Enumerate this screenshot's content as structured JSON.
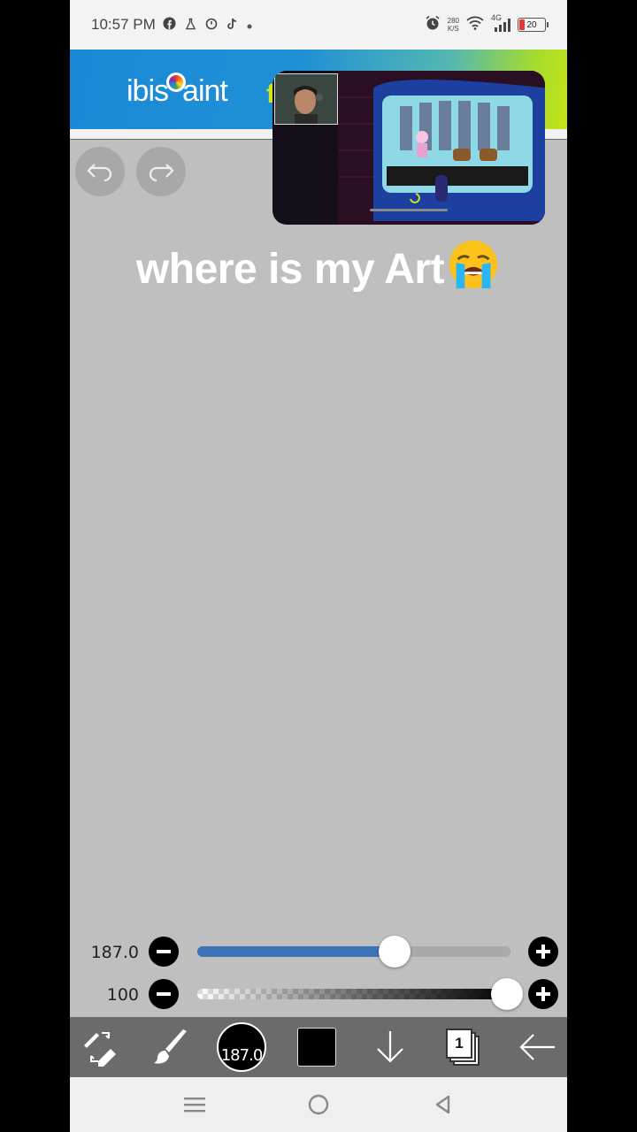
{
  "status_bar": {
    "time": "10:57 PM",
    "network_speed_value": "280",
    "network_speed_unit": "K/S",
    "network_type": "4G",
    "battery_level": "20",
    "icons": [
      "facebook-icon",
      "flask-icon",
      "alarm-clock-icon",
      "tiktok-icon",
      "dot-icon",
      "alarm-icon",
      "wifi-icon",
      "signal-icon",
      "battery-icon"
    ]
  },
  "ad": {
    "logo_prefix": "ibis",
    "logo_suffix": "aint",
    "trailing_letter": "f",
    "colors": {
      "blue": "#1f8fd6",
      "lime": "#c4e418"
    }
  },
  "canvas": {
    "caption": "where is my Art",
    "caption_emoji": "loudly-crying-face",
    "background": "#bfbfbf"
  },
  "sliders": {
    "brush_size": {
      "label": "187.0",
      "fraction": 0.63,
      "color": "#3f73b8"
    },
    "opacity": {
      "label": "100",
      "fraction": 1.0
    }
  },
  "toolbar": {
    "brush_size_label": "187.0",
    "layer_number": "1",
    "color": "#000000"
  }
}
